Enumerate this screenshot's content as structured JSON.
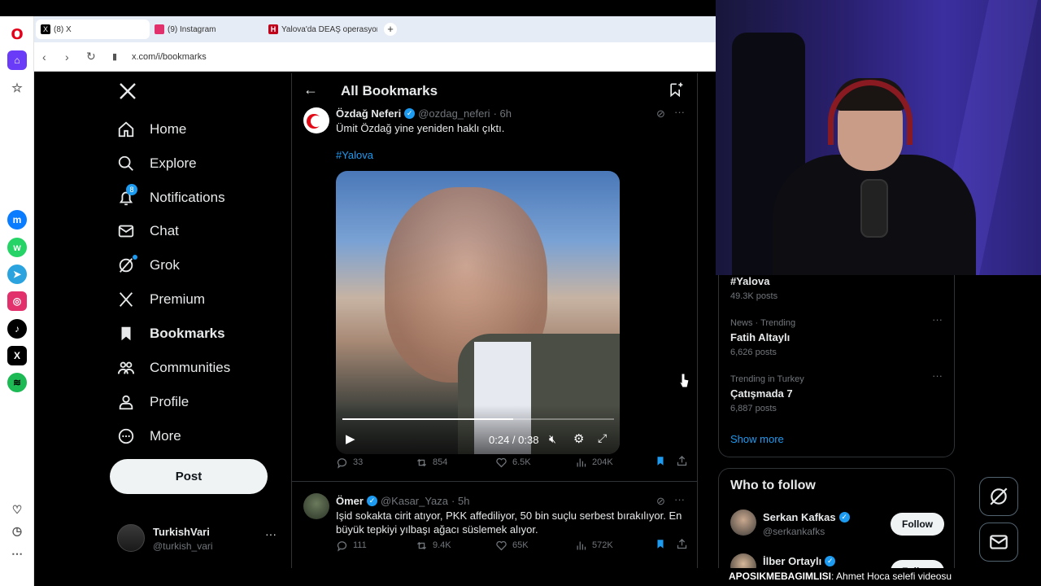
{
  "browser": {
    "tabs": [
      {
        "label": "(8) X"
      },
      {
        "label": "(9) Instagram"
      },
      {
        "label": "Yalova'da DEAŞ operasyon"
      }
    ],
    "url": "x.com/i/bookmarks"
  },
  "x_nav": {
    "items": [
      {
        "label": "Home"
      },
      {
        "label": "Explore"
      },
      {
        "label": "Notifications",
        "badge": "8"
      },
      {
        "label": "Chat"
      },
      {
        "label": "Grok"
      },
      {
        "label": "Premium"
      },
      {
        "label": "Bookmarks"
      },
      {
        "label": "Communities"
      },
      {
        "label": "Profile"
      },
      {
        "label": "More"
      }
    ],
    "post_label": "Post",
    "account": {
      "name": "TurkishVari",
      "handle": "@turkish_vari"
    }
  },
  "main": {
    "title": "All Bookmarks",
    "tweets": [
      {
        "name": "Özdağ Neferi",
        "handle": "@ozdag_neferi",
        "time": "· 6h",
        "text": "Ümit Özdağ yine yeniden haklı çıktı.",
        "hashtag": "#Yalova",
        "video_time": "0:24 / 0:38",
        "video_progress": 0.63,
        "stats": {
          "replies": "33",
          "reposts": "854",
          "likes": "6.5K",
          "views": "204K"
        }
      },
      {
        "name": "Ömer",
        "handle": "@Kasar_Yaza",
        "time": "· 5h",
        "text_line1": "Işid sokakta cirit atıyor, PKK affediliyor, 50 bin suçlu serbest bırakılıyor. En",
        "text_line2": "büyük tepkiyi yılbaşı ağacı süslemek alıyor.",
        "stats": {
          "replies": "111",
          "reposts": "9.4K",
          "likes": "65K",
          "views": "572K"
        }
      }
    ]
  },
  "right": {
    "trends": [
      {
        "context": "",
        "name": "#Yalova",
        "posts": "49.3K posts"
      },
      {
        "context": "News · Trending",
        "name": "Fatih Altaylı",
        "posts": "6,626 posts"
      },
      {
        "context": "Trending in Turkey",
        "name": "Çatışmada 7",
        "posts": "6,887 posts"
      }
    ],
    "show_more": "Show more",
    "who_to_follow": {
      "title": "Who to follow",
      "users": [
        {
          "name": "Serkan Kafkas",
          "handle": "@serkankafks",
          "button": "Follow"
        },
        {
          "name": "İlber Ortaylı",
          "handle": "",
          "button": "Follow"
        }
      ]
    }
  },
  "ticker": {
    "bold": "APOSIKMEBAGIMLISI",
    "text": ": Ahmet Hoca selefi videosu"
  },
  "colors": {
    "accent": "#1d9bf0",
    "background": "#000000",
    "border": "#2f3336",
    "muted": "#71767b"
  }
}
